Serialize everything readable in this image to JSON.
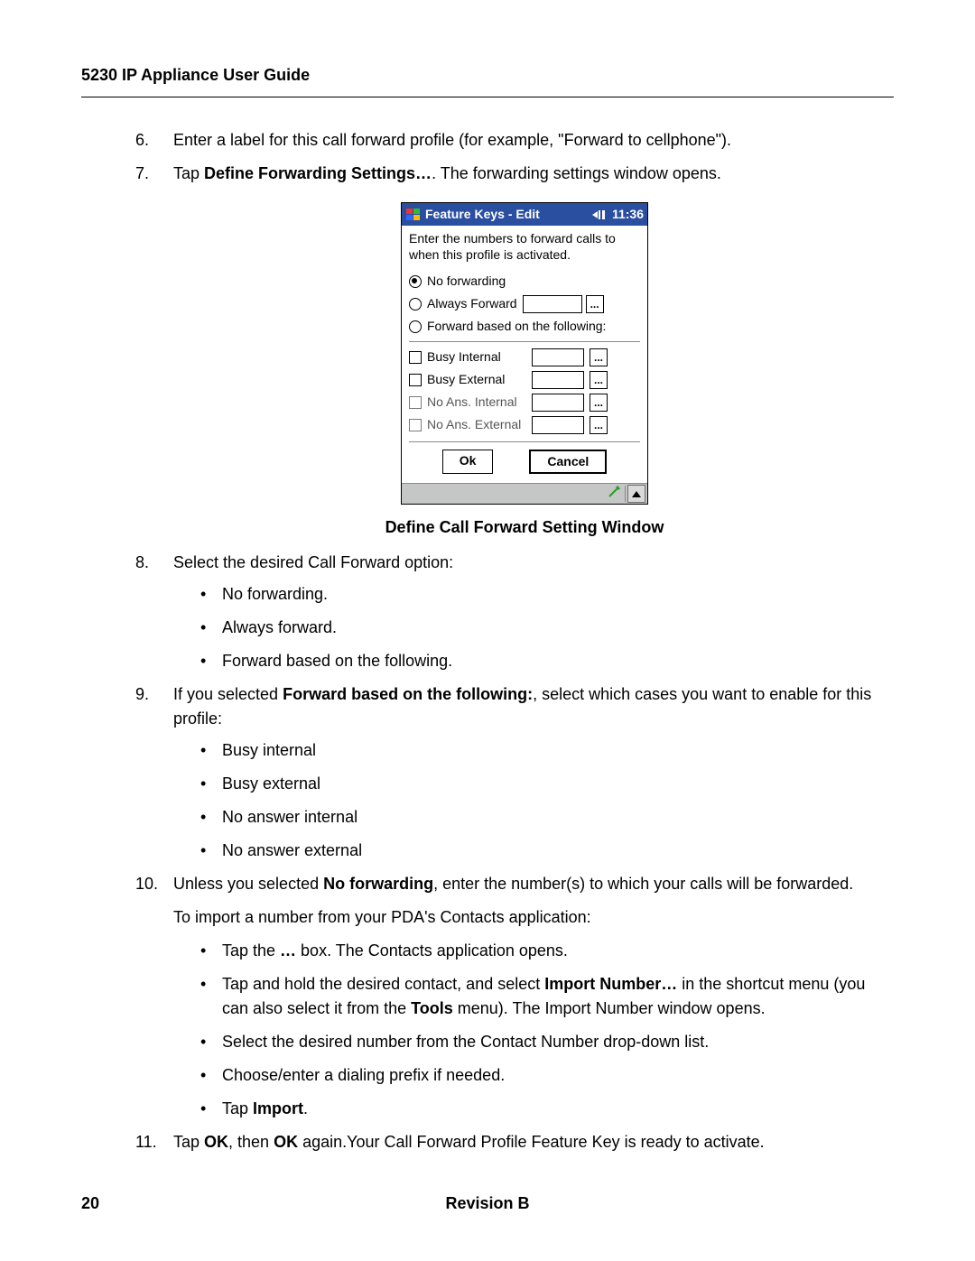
{
  "header": {
    "title": "5230 IP Appliance User Guide"
  },
  "steps": {
    "s6": {
      "num": "6.",
      "text": "Enter a label for this call forward profile (for example, \"Forward to cellphone\")."
    },
    "s7": {
      "num": "7.",
      "lead": "Tap ",
      "bold": "Define Forwarding Settings…",
      "tail": ". The forwarding settings window opens."
    },
    "s8": {
      "num": "8.",
      "text": "Select the desired Call Forward option:"
    },
    "s8_items": [
      "No forwarding.",
      "Always forward.",
      "Forward based on the following."
    ],
    "s9": {
      "num": "9.",
      "lead": "If you selected ",
      "bold": "Forward based on the following:",
      "tail": ", select which cases you want to enable for this profile:"
    },
    "s9_items": [
      "Busy internal",
      "Busy external",
      "No answer internal",
      "No answer external"
    ],
    "s10": {
      "num": "10.",
      "lead": "Unless you selected ",
      "bold": "No forwarding",
      "tail": ", enter the number(s) to which your calls will be forwarded."
    },
    "s10p": "To import a number from your PDA's Contacts application:",
    "s10_items": {
      "i1": {
        "lead": "Tap the ",
        "bold": "…",
        "tail": " box. The Contacts application opens."
      },
      "i2": {
        "lead": "Tap and hold the desired contact, and select ",
        "bold": "Import Number…",
        "mid": " in the shortcut menu (you can also select it from the ",
        "bold2": "Tools",
        "tail": " menu). The Import Number window opens."
      },
      "i3": "Select the desired number from the Contact Number drop-down list.",
      "i4": "Choose/enter a dialing prefix if needed.",
      "i5": {
        "lead": "Tap ",
        "bold": "Import",
        "tail": "."
      }
    },
    "s11": {
      "num": "11.",
      "lead": "Tap ",
      "bold": "OK",
      "mid": ", then ",
      "bold2": "OK",
      "tail": " again.Your Call Forward Profile Feature Key is ready to activate."
    }
  },
  "caption": "Define Call Forward Setting Window",
  "pda": {
    "title": "Feature Keys  -  Edit",
    "time": "11:36",
    "instruction": "Enter the numbers to forward calls to when this profile is activated.",
    "radios": {
      "none": "No forwarding",
      "always": "Always Forward",
      "cond": "Forward based on the following:"
    },
    "checks": {
      "bi": "Busy Internal",
      "be": "Busy External",
      "ni": "No Ans. Internal",
      "ne": "No Ans. External"
    },
    "buttons": {
      "ok": "Ok",
      "cancel": "Cancel",
      "dots": "..."
    }
  },
  "footer": {
    "page": "20",
    "rev": "Revision B"
  }
}
